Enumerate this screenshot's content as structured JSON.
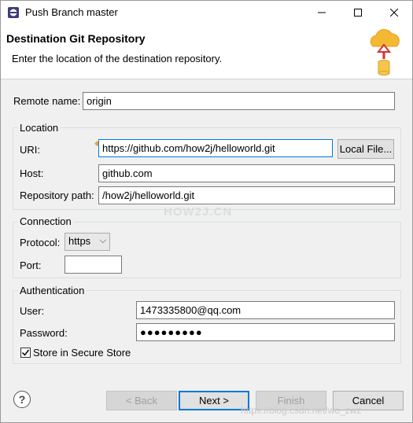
{
  "window": {
    "title": "Push Branch master",
    "minimize_icon": "minimize-icon",
    "maximize_icon": "maximize-icon",
    "close_icon": "close-icon"
  },
  "banner": {
    "title": "Destination Git Repository",
    "description": "Enter the location of the destination repository.",
    "icon": "cloud-push-icon"
  },
  "remote_name": {
    "label": "Remote name:",
    "value": "origin"
  },
  "location": {
    "group_label": "Location",
    "uri": {
      "label": "URI:",
      "value": "https://github.com/how2j/helloworld.git"
    },
    "local_file_button": "Local File...",
    "host": {
      "label": "Host:",
      "value": "github.com"
    },
    "repo_path": {
      "label": "Repository path:",
      "value": "/how2j/helloworld.git"
    }
  },
  "connection": {
    "group_label": "Connection",
    "protocol": {
      "label": "Protocol:",
      "value": "https"
    },
    "port": {
      "label": "Port:",
      "value": ""
    }
  },
  "authentication": {
    "group_label": "Authentication",
    "user": {
      "label": "User:",
      "value": "1473335800@qq.com"
    },
    "password": {
      "label": "Password:",
      "value": "●●●●●●●●●"
    },
    "store": {
      "label": "Store in Secure Store",
      "checked": true
    }
  },
  "watermark": "HOW2J.CN",
  "watermark_url": "https://blog.csdn.net/wo_zwz",
  "footer": {
    "help_icon": "help-icon",
    "back": "< Back",
    "next": "Next >",
    "finish": "Finish",
    "cancel": "Cancel"
  },
  "colors": {
    "accent": "#0078d7",
    "cloud": "#f5b833"
  }
}
